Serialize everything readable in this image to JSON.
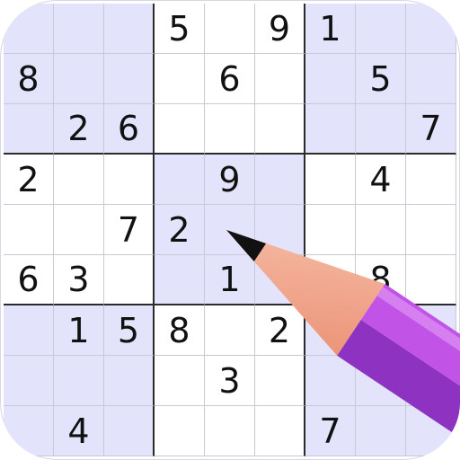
{
  "game": {
    "name": "sudoku",
    "colors": {
      "shade": "#e3e3fb",
      "grid_line": "#c9c9d6",
      "box_line": "#2a2a2a",
      "digit": "#111111",
      "pencil_body": "#c154e6",
      "pencil_dark": "#8e32c2",
      "pencil_wood": "#f2a98e",
      "pencil_tip": "#111111"
    },
    "shaded_boxes": [
      0,
      2,
      4,
      6,
      8
    ],
    "board": [
      [
        "",
        "",
        "",
        "5",
        "",
        "9",
        "1",
        "",
        ""
      ],
      [
        "8",
        "",
        "",
        "",
        "6",
        "",
        "",
        "5",
        ""
      ],
      [
        "",
        "2",
        "6",
        "",
        "",
        "",
        "",
        "",
        "7"
      ],
      [
        "2",
        "",
        "",
        "",
        "9",
        "",
        "",
        "4",
        ""
      ],
      [
        "",
        "",
        "7",
        "2",
        "",
        "",
        "",
        "",
        ""
      ],
      [
        "6",
        "3",
        "",
        "",
        "1",
        "",
        "",
        "8",
        ""
      ],
      [
        "",
        "1",
        "5",
        "8",
        "",
        "2",
        "",
        "",
        ""
      ],
      [
        "",
        "",
        "",
        "",
        "3",
        "",
        "",
        "",
        ""
      ],
      [
        "",
        "4",
        "",
        "",
        "",
        "",
        "7",
        "",
        ""
      ]
    ],
    "pencil_icon": "pencil-icon"
  }
}
